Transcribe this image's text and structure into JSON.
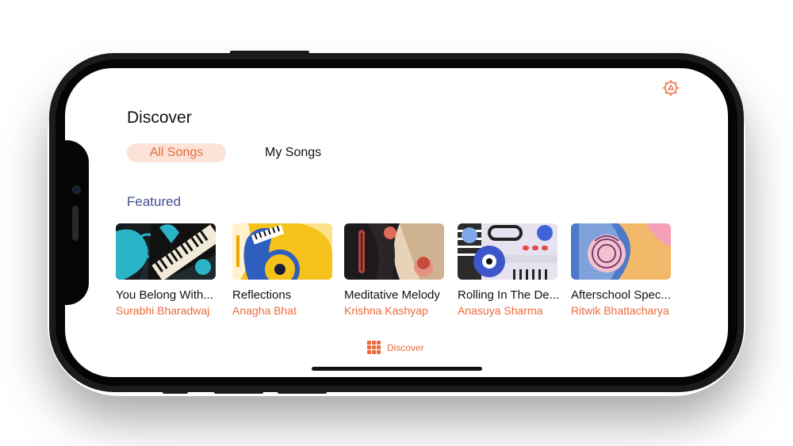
{
  "header": {
    "title": "Discover"
  },
  "segments": {
    "all_songs": "All Songs",
    "my_songs": "My Songs"
  },
  "featured": {
    "heading": "Featured",
    "items": [
      {
        "title": "You Belong With...",
        "artist": "Surabhi Bharadwaj"
      },
      {
        "title": "Reflections",
        "artist": "Anagha Bhat"
      },
      {
        "title": "Meditative Melody",
        "artist": "Krishna Kashyap"
      },
      {
        "title": "Rolling In The De...",
        "artist": "Anasuya Sharma"
      },
      {
        "title": "Afterschool Spec...",
        "artist": "Ritwik Bhattacharya"
      }
    ]
  },
  "tabbar": {
    "discover_label": "Discover"
  },
  "icons": {
    "settings": "gear-icon",
    "tab": "grid-icon"
  },
  "colors": {
    "accent": "#ec6a3b",
    "accent_light": "#fbe3d8",
    "featured": "#3f4f8a"
  }
}
